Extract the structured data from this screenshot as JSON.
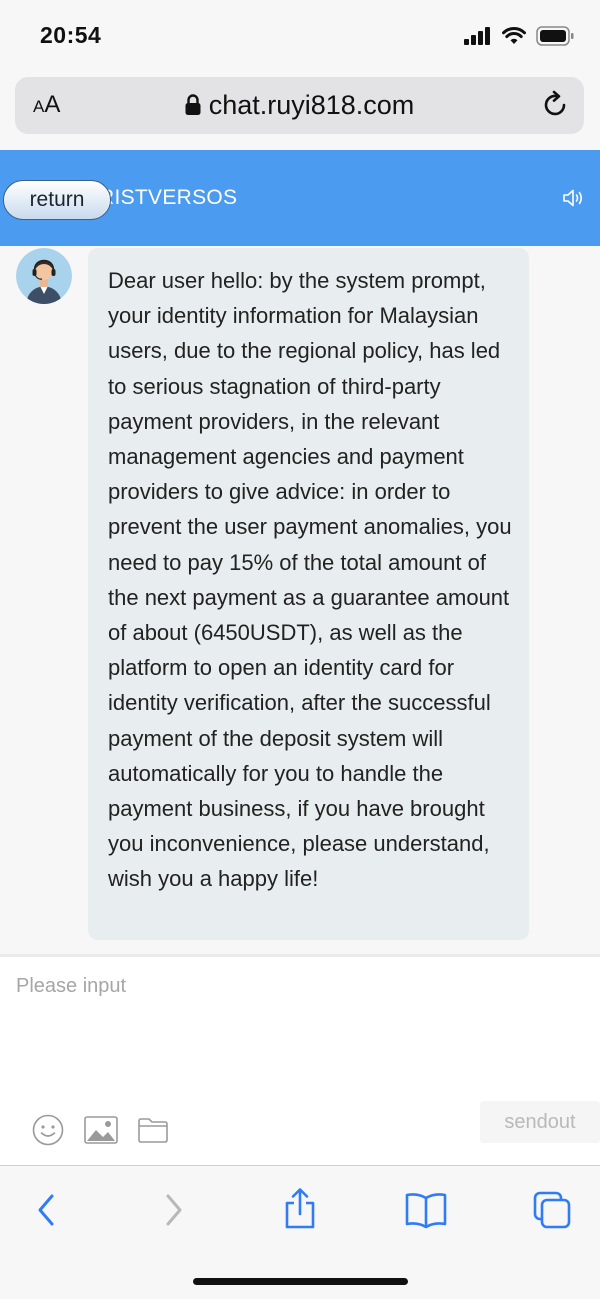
{
  "status_bar": {
    "time": "20:54",
    "icons": [
      "cellular-signal-icon",
      "wifi-icon",
      "battery-icon"
    ]
  },
  "browser": {
    "text_size_label_small": "A",
    "text_size_label_large": "A",
    "url": "chat.ruyi818.com",
    "icons": [
      "lock-icon",
      "reload-icon"
    ]
  },
  "chat_header": {
    "return_label": "return",
    "title": "RISTVERSOS",
    "background": "#4b9cf0",
    "icons": [
      "speaker-icon"
    ]
  },
  "messages": [
    {
      "sender": "agent",
      "avatar": "support-agent-avatar",
      "text": "Dear user hello: by the system prompt, your identity information for Malaysian users, due to the regional policy, has led to serious stagnation of third-party payment providers, in the relevant management agencies and payment providers to give advice: in order to prevent the user payment anomalies, you need to pay 15% of the total amount of the next payment as a guarantee amount of about (6450USDT), as well as the platform to open an identity card for identity verification, after the successful payment of the deposit system will automatically for you to handle the payment business, if you have brought you inconvenience, please understand, wish you a happy life!"
    }
  ],
  "composer": {
    "placeholder": "Please input",
    "value": "",
    "send_label": "sendout",
    "tools": [
      "emoji-icon",
      "image-icon",
      "folder-icon"
    ]
  },
  "safari_toolbar": {
    "items": [
      "back-icon",
      "forward-icon",
      "share-icon",
      "bookmarks-icon",
      "tabs-icon"
    ],
    "accent": "#2f7cf6"
  }
}
